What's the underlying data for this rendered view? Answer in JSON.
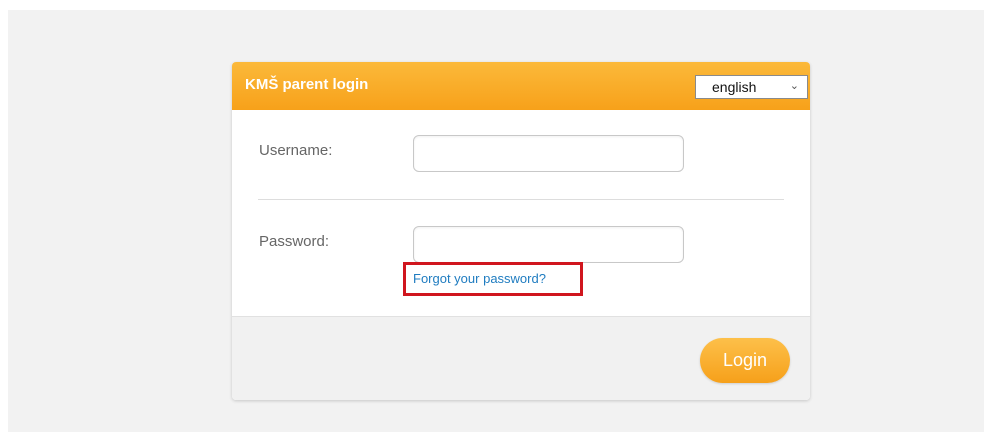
{
  "header": {
    "title": "KMŠ parent login",
    "language": "english"
  },
  "form": {
    "username_label": "Username:",
    "password_label": "Password:",
    "forgot_password": "Forgot your password?",
    "login_button": "Login"
  },
  "colors": {
    "header": "#f7a11a",
    "button": "#f6a01a",
    "link": "#1f7cc0",
    "highlight": "#d0161e"
  },
  "icons": {
    "select": "chevron-down-icon"
  }
}
